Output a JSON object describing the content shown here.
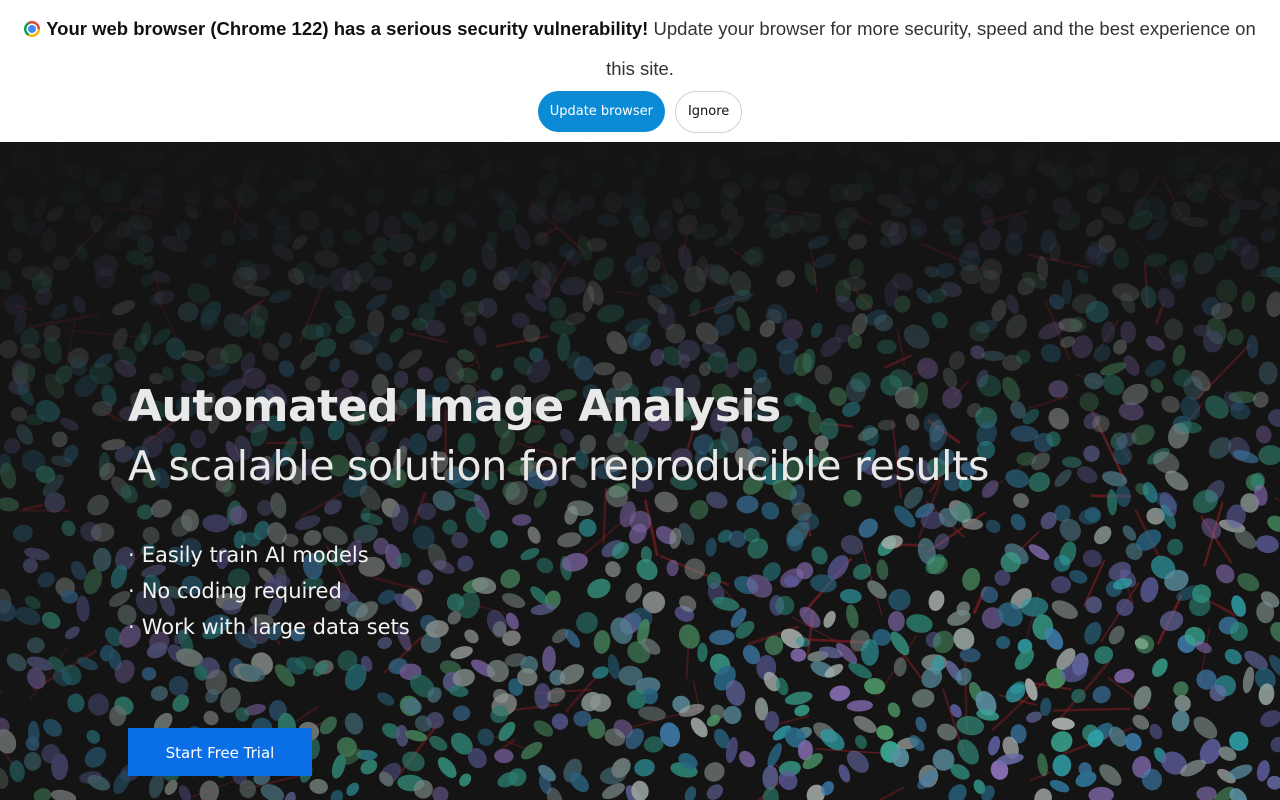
{
  "banner": {
    "icon": "chrome-icon",
    "warning_strong": "Your web browser (Chrome 122) has a serious security vulnerability!",
    "warning_rest": "Update your browser for more security, speed and the best experience on this site.",
    "update_label": "Update browser",
    "ignore_label": "Ignore",
    "colors": {
      "update_button": "#0b8ad6",
      "background": "#ffffff"
    }
  },
  "hero": {
    "title": "Automated Image Analysis",
    "subtitle": "A scalable solution for reproducible results",
    "bullet_marker": "·",
    "bullets": [
      "Easily train AI models",
      "No coding required",
      "Work with large data sets"
    ],
    "cta_label": "Start Free Trial",
    "colors": {
      "cta": "#0a6ee6",
      "text": "#e9e9e9"
    },
    "background": "fluorescence microscopy image of stained cell nuclei"
  }
}
